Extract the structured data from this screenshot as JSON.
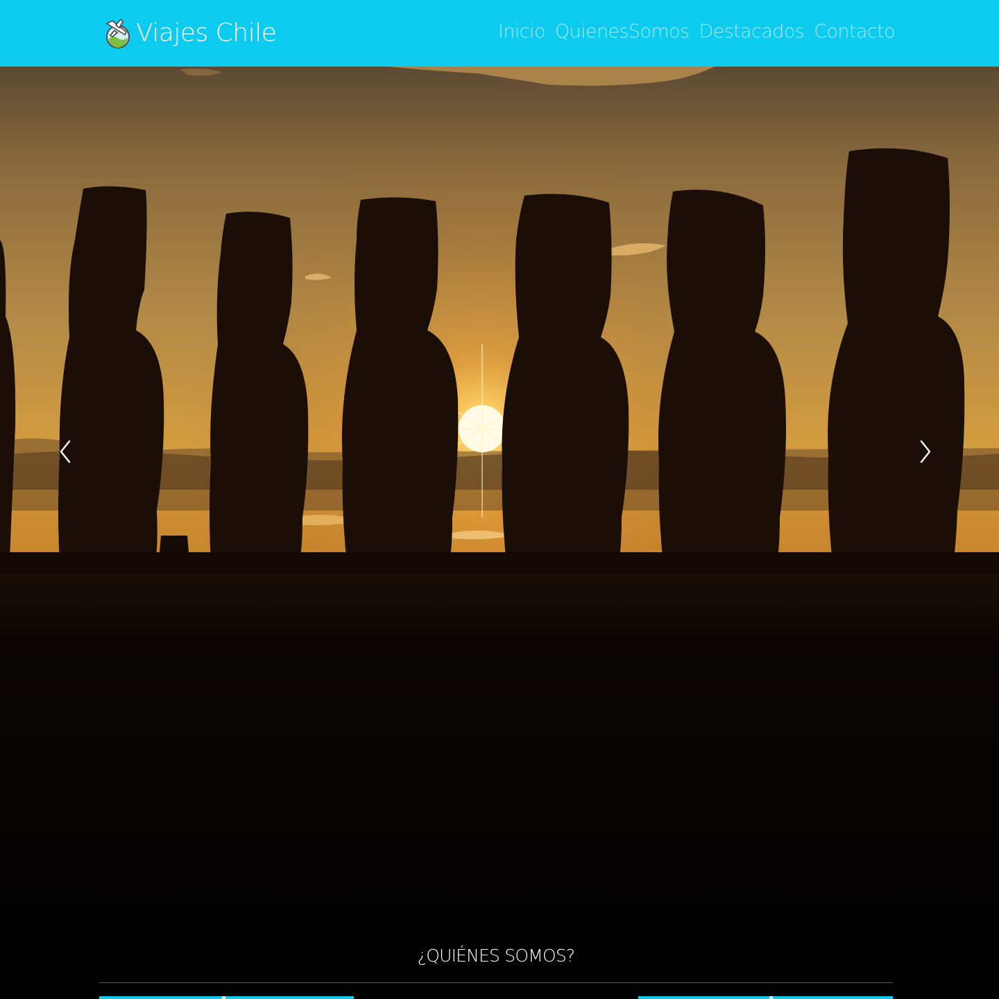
{
  "navbar": {
    "brand": {
      "text": "Viajes Chile",
      "logo_icon": "globe-airplane-icon"
    },
    "links": [
      {
        "label": "Inicio"
      },
      {
        "label": "QuienesSomos"
      },
      {
        "label": "Destacados"
      },
      {
        "label": "Contacto"
      }
    ],
    "background_color": "#0ccbef"
  },
  "carousel": {
    "slide_image": "moai-statues-sunset-photo",
    "prev_icon": "chevron-left-icon",
    "next_icon": "chevron-right-icon"
  },
  "about": {
    "title": "¿QUIÉNES SOMOS?",
    "accent_color": "#0ccbef"
  }
}
